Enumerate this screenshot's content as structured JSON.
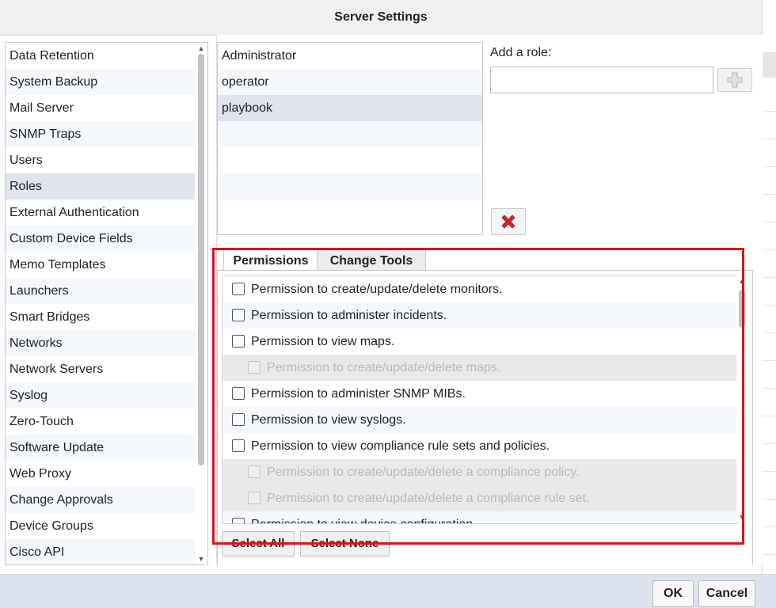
{
  "window": {
    "title": "Server Settings"
  },
  "nav": {
    "items": [
      "Data Retention",
      "System Backup",
      "Mail Server",
      "SNMP Traps",
      "Users",
      "Roles",
      "External Authentication",
      "Custom Device Fields",
      "Memo Templates",
      "Launchers",
      "Smart Bridges",
      "Networks",
      "Network Servers",
      "Syslog",
      "Zero-Touch",
      "Software Update",
      "Web Proxy",
      "Change Approvals",
      "Device Groups",
      "Cisco API"
    ],
    "selected": "Roles"
  },
  "roles": {
    "items": [
      "Administrator",
      "operator",
      "playbook"
    ],
    "selected": "playbook"
  },
  "add_role": {
    "label": "Add a role:",
    "value": "",
    "add_icon": "plus-icon"
  },
  "delete_icon": "red-x-icon",
  "tabs": [
    "Permissions",
    "Change Tools"
  ],
  "active_tab": "Permissions",
  "permissions": [
    {
      "label": "Permission to create/update/delete monitors.",
      "checked": false,
      "enabled": true,
      "level": 0
    },
    {
      "label": "Permission to administer incidents.",
      "checked": false,
      "enabled": true,
      "level": 0
    },
    {
      "label": "Permission to view maps.",
      "checked": false,
      "enabled": true,
      "level": 0
    },
    {
      "label": "Permission to create/update/delete maps.",
      "checked": false,
      "enabled": false,
      "level": 1
    },
    {
      "label": "Permission to administer SNMP MIBs.",
      "checked": false,
      "enabled": true,
      "level": 0
    },
    {
      "label": "Permission to view syslogs.",
      "checked": false,
      "enabled": true,
      "level": 0
    },
    {
      "label": "Permission to view compliance rule sets and policies.",
      "checked": false,
      "enabled": true,
      "level": 0
    },
    {
      "label": "Permission to create/update/delete a compliance policy.",
      "checked": false,
      "enabled": false,
      "level": 1
    },
    {
      "label": "Permission to create/update/delete a compliance rule set.",
      "checked": false,
      "enabled": false,
      "level": 1
    },
    {
      "label": "Permission to view device configuration.",
      "checked": false,
      "enabled": true,
      "level": 0
    }
  ],
  "buttons": {
    "select_all": "Select All",
    "select_none": "Select None",
    "ok": "OK",
    "cancel": "Cancel"
  },
  "colors": {
    "highlight": "#e0101a",
    "selected_row": "#dfe4ee",
    "footer": "#dde3ee",
    "delete": "#d8232a"
  }
}
